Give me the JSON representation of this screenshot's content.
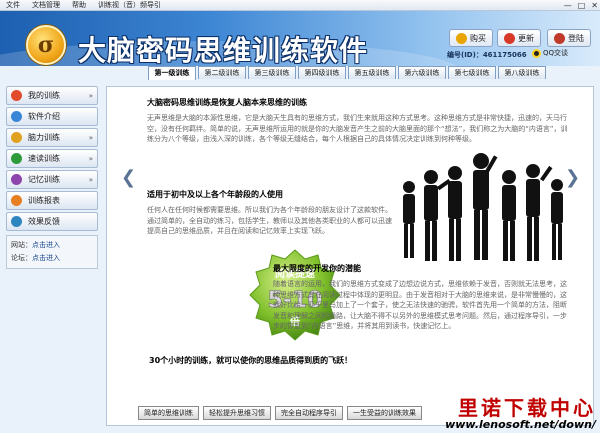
{
  "menu": [
    "文件",
    "文档管理",
    "帮助",
    "训练视（音）频导引"
  ],
  "window_controls": [
    "—",
    "□",
    "✕"
  ],
  "app_title": "大脑密码思维训练软件",
  "header_buttons": [
    {
      "label": "购买",
      "icon": "cart-icon",
      "color": "#e8a500"
    },
    {
      "label": "更新",
      "icon": "refresh-icon",
      "color": "#d83a2a"
    },
    {
      "label": "登陆",
      "icon": "login-icon",
      "color": "#c0392b"
    }
  ],
  "phone_label": "编号(ID)：461175066",
  "qq_label": "QQ交谈",
  "tabs": [
    "第一级训练",
    "第二级训练",
    "第三级训练",
    "第四级训练",
    "第五级训练",
    "第六级训练",
    "第七级训练",
    "第八级训练"
  ],
  "active_tab": 0,
  "sidebar": {
    "items": [
      {
        "label": "我的训练",
        "icon": "train-icon",
        "color": "#e24b2b",
        "chevron": "»"
      },
      {
        "label": "软件介绍",
        "icon": "info-icon",
        "color": "#3a87d8",
        "chevron": ""
      },
      {
        "label": "脑力训练",
        "icon": "brain-icon",
        "color": "#e0a020",
        "chevron": "»"
      },
      {
        "label": "速读训练",
        "icon": "speed-icon",
        "color": "#2d9b3a",
        "chevron": "»"
      },
      {
        "label": "记忆训练",
        "icon": "memory-icon",
        "color": "#8e44ad",
        "chevron": "»"
      },
      {
        "label": "训练报表",
        "icon": "report-icon",
        "color": "#e67e22",
        "chevron": ""
      },
      {
        "label": "效果反馈",
        "icon": "feedback-icon",
        "color": "#2e86c1",
        "chevron": ""
      }
    ],
    "links": [
      {
        "label": "网站：",
        "value": "点击进入"
      },
      {
        "label": "论坛：",
        "value": "点击进入"
      }
    ]
  },
  "content": {
    "heading1": "大脑密码思维训练是恢复人脑本来思维的训练",
    "para1": "无声思维是大脑的本源性思维，它是大脑天生具有的思维方式，我们生来就用这种方式思考。这种思维方式是非常快捷，迅速的，天马行空，没有任何羁绊。简单的说，无声思维所运用的就是你的大脑发音产生之前的大脑里面的那个“想法”，我们称之为大脑的“内语言”，训练分为八个等级，由浅入深的训练，各个等级无缝结合，每个人根据自己的具体情况决定训练到何种等级。",
    "heading2": "适用于初中及以上各个年龄段的人使用",
    "para2": "任何人在任何时候都需要思维。所以我们为各个年龄段的朋友设计了这款软件。通过简单的，全自动的练习，包括学生，教师以及其他各类职业的人都可以迅速提高自己的思维品质，并且在阅读和记忆效率上实现飞跃。",
    "heading3": "最大限度的开发你的潜能",
    "para3": "随着语言的运用，我们的思维方式变成了边想边说方式，思维依赖于发音，否则就无法思考，这种思维方式其在阅读过程中体现的更明显。由于发音相对于大脑的思维来说，是非常慢慢的，这就好比给一匹千里马加上了一个套子，使之无法快速的驰骋，软件首先用一个简单的方法，阻断发音和理解之间的通路，让大脑不得不以另外的思维模式思考问题。然后，通过程序导引，一步步的恢复到“内语言”思维，并将其用到读书，快速记忆上。",
    "footer": "30个小时的训练，就可以使你的思维品质得到质的飞跃！",
    "badge_top": "阅读提速",
    "badge_num": "5-10",
    "badge_bottom": "倍"
  },
  "bottom_buttons": [
    "简单的思维训练",
    "轻松提升思维习惯",
    "完全自动程序导引",
    "一生受益的训练效果"
  ],
  "watermark": {
    "title": "里诺下载中心",
    "url": "www.lenosoft.net/down/"
  }
}
